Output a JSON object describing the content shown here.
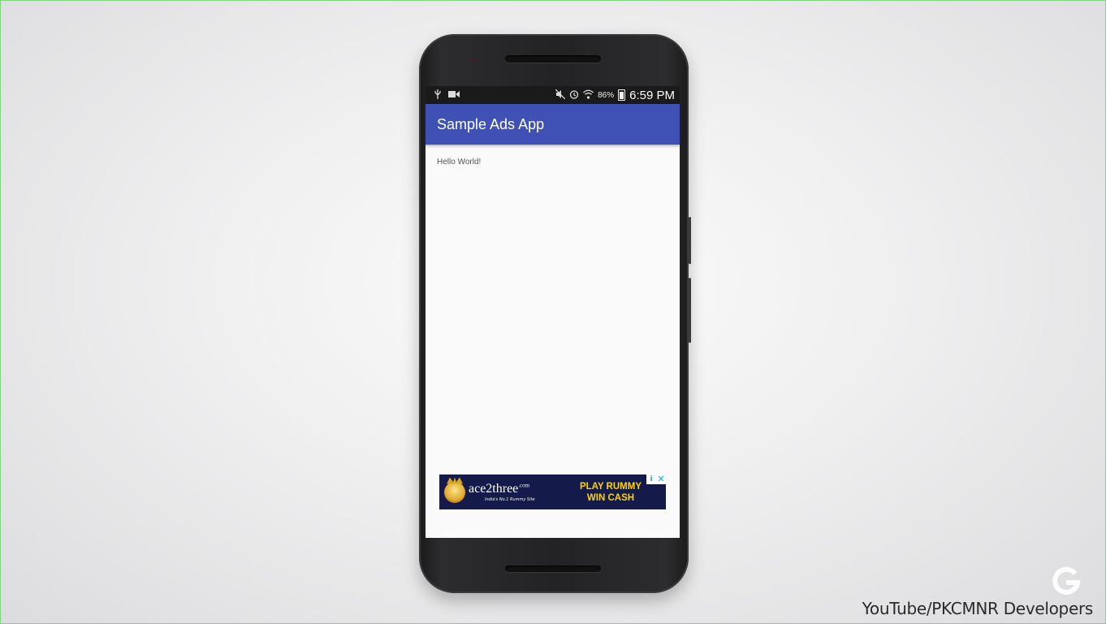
{
  "status_bar": {
    "left_icons": [
      "usb-icon",
      "video-icon"
    ],
    "right_icons": [
      "mute-icon",
      "alarm-icon",
      "wifi-icon"
    ],
    "battery_percent": "86%",
    "time": "6:59 PM"
  },
  "app_bar": {
    "title": "Sample Ads App",
    "color": "#3f51b5"
  },
  "content": {
    "text": "Hello World!"
  },
  "ad_banner": {
    "brand": "ace2three",
    "brand_suffix": ".com",
    "tagline": "India's No.1 Rummy Site",
    "cta_line1": "PLAY RUMMY",
    "cta_line2": "WIN CASH",
    "adchoices_icon": "i",
    "close_icon": "✕",
    "background": "#141a4a",
    "cta_color": "#ffd400"
  },
  "overlay": {
    "watermark_icon": "google-g-icon",
    "credit": "YouTube/PKCMNR Developers"
  }
}
